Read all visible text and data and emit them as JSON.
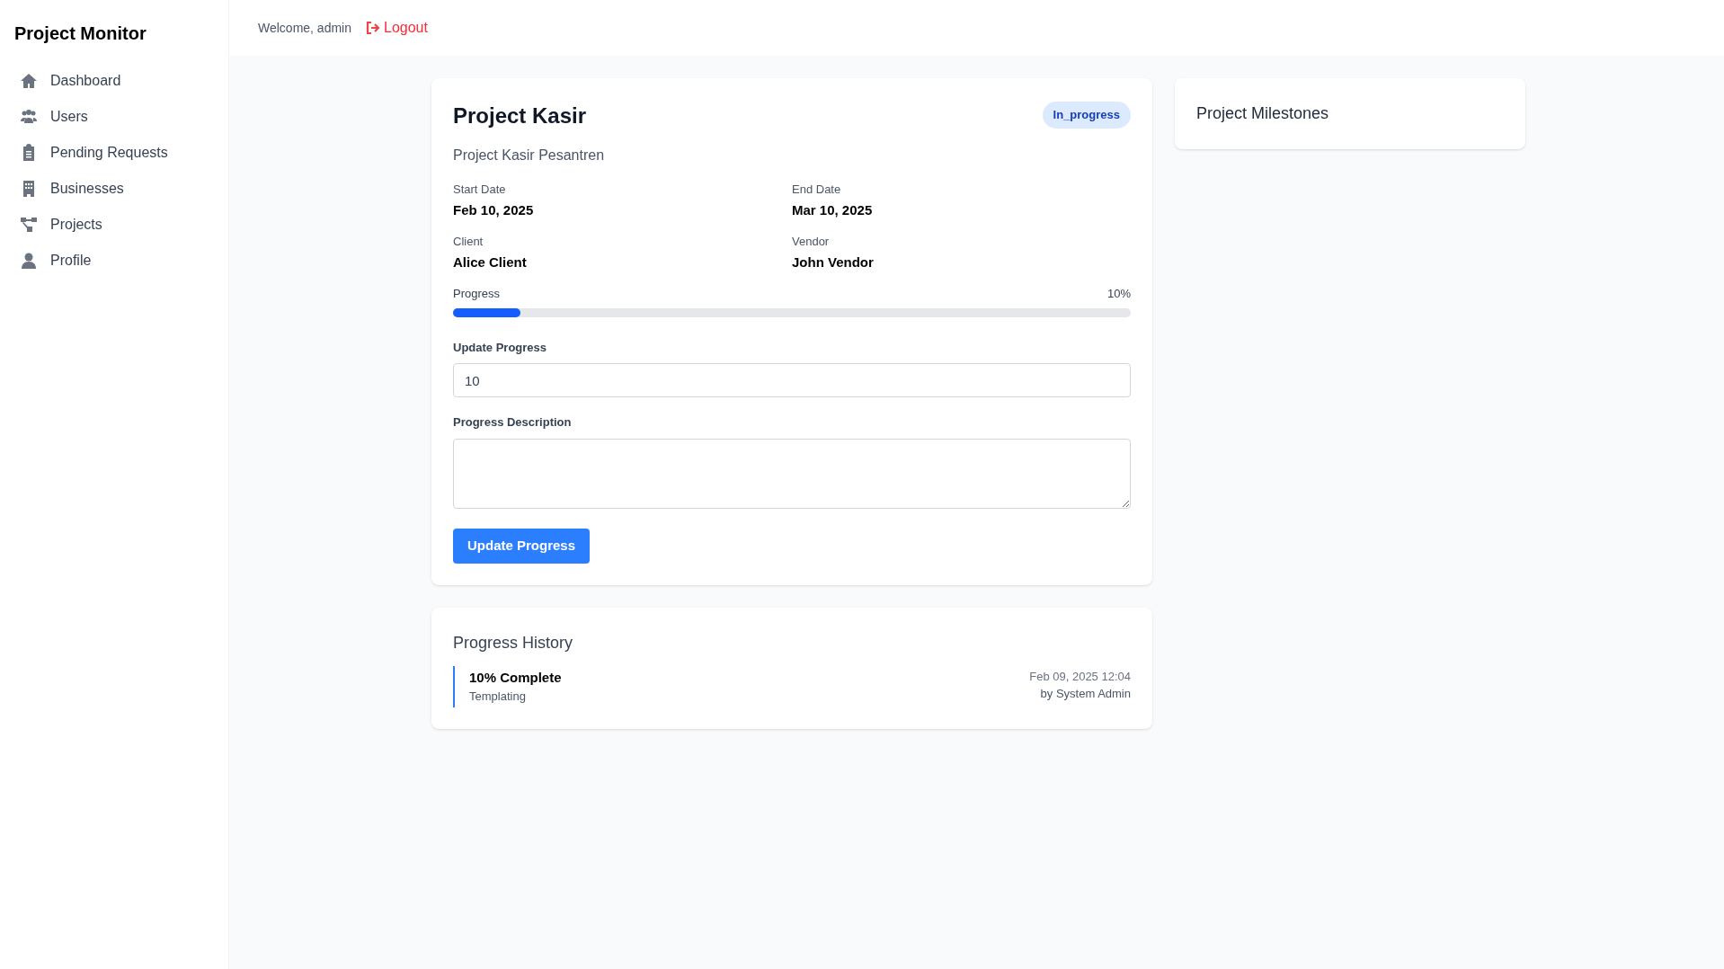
{
  "sidebar": {
    "title": "Project Monitor",
    "items": [
      {
        "kind": "home",
        "label": "Dashboard"
      },
      {
        "kind": "users",
        "label": "Users"
      },
      {
        "kind": "clipboard",
        "label": "Pending Requests"
      },
      {
        "kind": "building",
        "label": "Businesses"
      },
      {
        "kind": "sitemap",
        "label": "Projects"
      },
      {
        "kind": "user",
        "label": "Profile"
      }
    ]
  },
  "header": {
    "welcome": "Welcome, admin",
    "logout": "Logout"
  },
  "project": {
    "title": "Project Kasir",
    "status": "In_progress",
    "description": "Project Kasir Pesantren",
    "fields": [
      {
        "label": "Start Date",
        "value": "Feb 10, 2025"
      },
      {
        "label": "End Date",
        "value": "Mar 10, 2025"
      },
      {
        "label": "Client",
        "value": "Alice Client"
      },
      {
        "label": "Vendor",
        "value": "John Vendor"
      }
    ],
    "progress": {
      "label": "Progress",
      "reading": "10%",
      "level": 0.1
    },
    "update_progress": {
      "label": "Update Progress",
      "value": "10"
    },
    "progress_description": {
      "label": "Progress Description"
    },
    "button": "Update Progress"
  },
  "history": {
    "title": "Progress History",
    "entries": [
      {
        "title": "10% Complete",
        "note": "Templating",
        "time": "Feb 09, 2025 12:04",
        "by": "by System Admin"
      }
    ]
  },
  "milestones": {
    "title": "Project Milestones"
  }
}
